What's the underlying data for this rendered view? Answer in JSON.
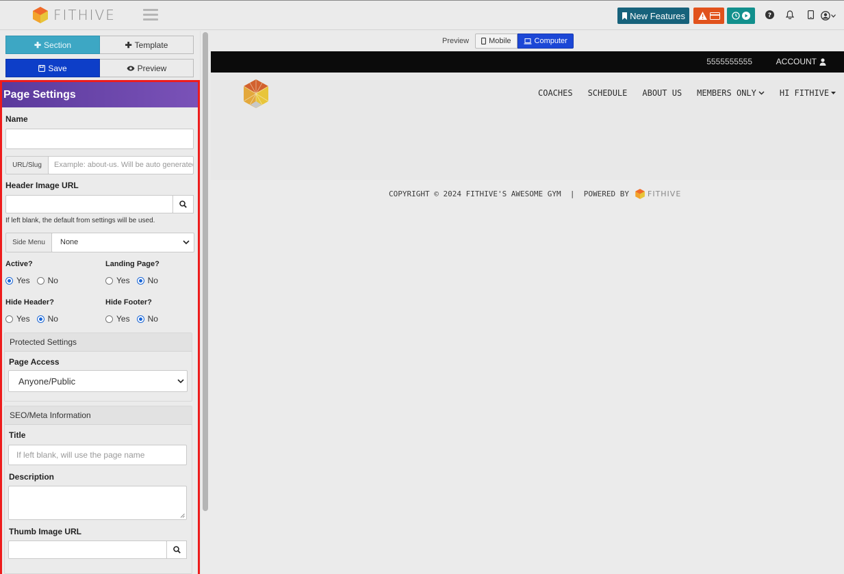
{
  "app": {
    "logo_text": "FITHIVE"
  },
  "topbar": {
    "new_features_label": "New Features"
  },
  "sidebar": {
    "section_label": "Section",
    "template_label": "Template",
    "save_label": "Save",
    "preview_label": "Preview"
  },
  "page_settings": {
    "title": "Page Settings",
    "name_label": "Name",
    "name_value": "",
    "slug_addon": "URL/Slug",
    "slug_placeholder": "Example: about-us. Will be auto generated",
    "header_image_label": "Header Image URL",
    "header_image_value": "",
    "header_image_help": "If left blank, the default from settings will be used.",
    "side_menu_addon": "Side Menu",
    "side_menu_value": "None",
    "active_label": "Active?",
    "landing_label": "Landing Page?",
    "hide_header_label": "Hide Header?",
    "hide_footer_label": "Hide Footer?",
    "yes": "Yes",
    "no": "No",
    "active": "yes",
    "landing": "no",
    "hide_header": "no",
    "hide_footer": "no"
  },
  "protected": {
    "heading": "Protected Settings",
    "access_label": "Page Access",
    "access_value": "Anyone/Public"
  },
  "seo": {
    "heading": "SEO/Meta Information",
    "title_label": "Title",
    "title_placeholder": "If left blank, will use the page name",
    "description_label": "Description",
    "thumb_label": "Thumb Image URL"
  },
  "preview": {
    "label": "Preview",
    "mobile_label": "Mobile",
    "computer_label": "Computer"
  },
  "site": {
    "phone": "5555555555",
    "account_label": "ACCOUNT",
    "nav": [
      "COACHES",
      "SCHEDULE",
      "ABOUT US",
      "MEMBERS ONLY",
      "HI FITHIVE"
    ],
    "footer_text": "COPYRIGHT © 2024 FITHIVE'S AWESOME GYM  |  POWERED BY",
    "footer_logo_text": "FITHIVE"
  },
  "colors": {
    "header_purple": "#6b47ac",
    "save_blue": "#0d3ec8",
    "section_teal": "#3da7c4",
    "alert_orange": "#e1521c",
    "time_teal": "#12908d",
    "new_features": "#17627b",
    "highlight_red": "#ee1c1c"
  }
}
